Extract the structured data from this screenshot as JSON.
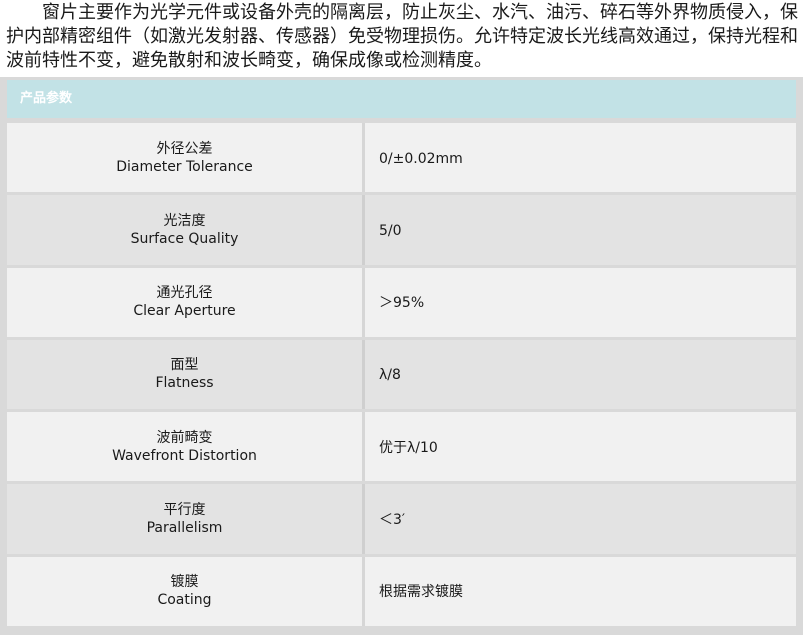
{
  "intro": "窗片主要作为光学元件或设备外壳的隔离层，防止灰尘、水汽、油污、碎石等外界物质侵入，保护内部精密组件（如激光发射器、传感器）免受物理损伤。允许特定波长光线高效通过，保持光程和波前特性不变，避免散射和波长畸变，确保成像或检测精度。",
  "panel": {
    "title": "产品参数"
  },
  "specs": [
    {
      "cn": "外径公差",
      "en": "Diameter Tolerance",
      "value": "0/±0.02mm"
    },
    {
      "cn": "光洁度",
      "en": "Surface Quality",
      "value": "5/0"
    },
    {
      "cn": "通光孔径",
      "en": "Clear Aperture",
      "value": "＞95%"
    },
    {
      "cn": "面型",
      "en": "Flatness",
      "value": "λ/8"
    },
    {
      "cn": "波前畸变",
      "en": "Wavefront Distortion",
      "value": "优于λ/10"
    },
    {
      "cn": "平行度",
      "en": "Parallelism",
      "value": "＜3′"
    },
    {
      "cn": "镀膜",
      "en": "Coating",
      "value": "根据需求镀膜"
    }
  ]
}
